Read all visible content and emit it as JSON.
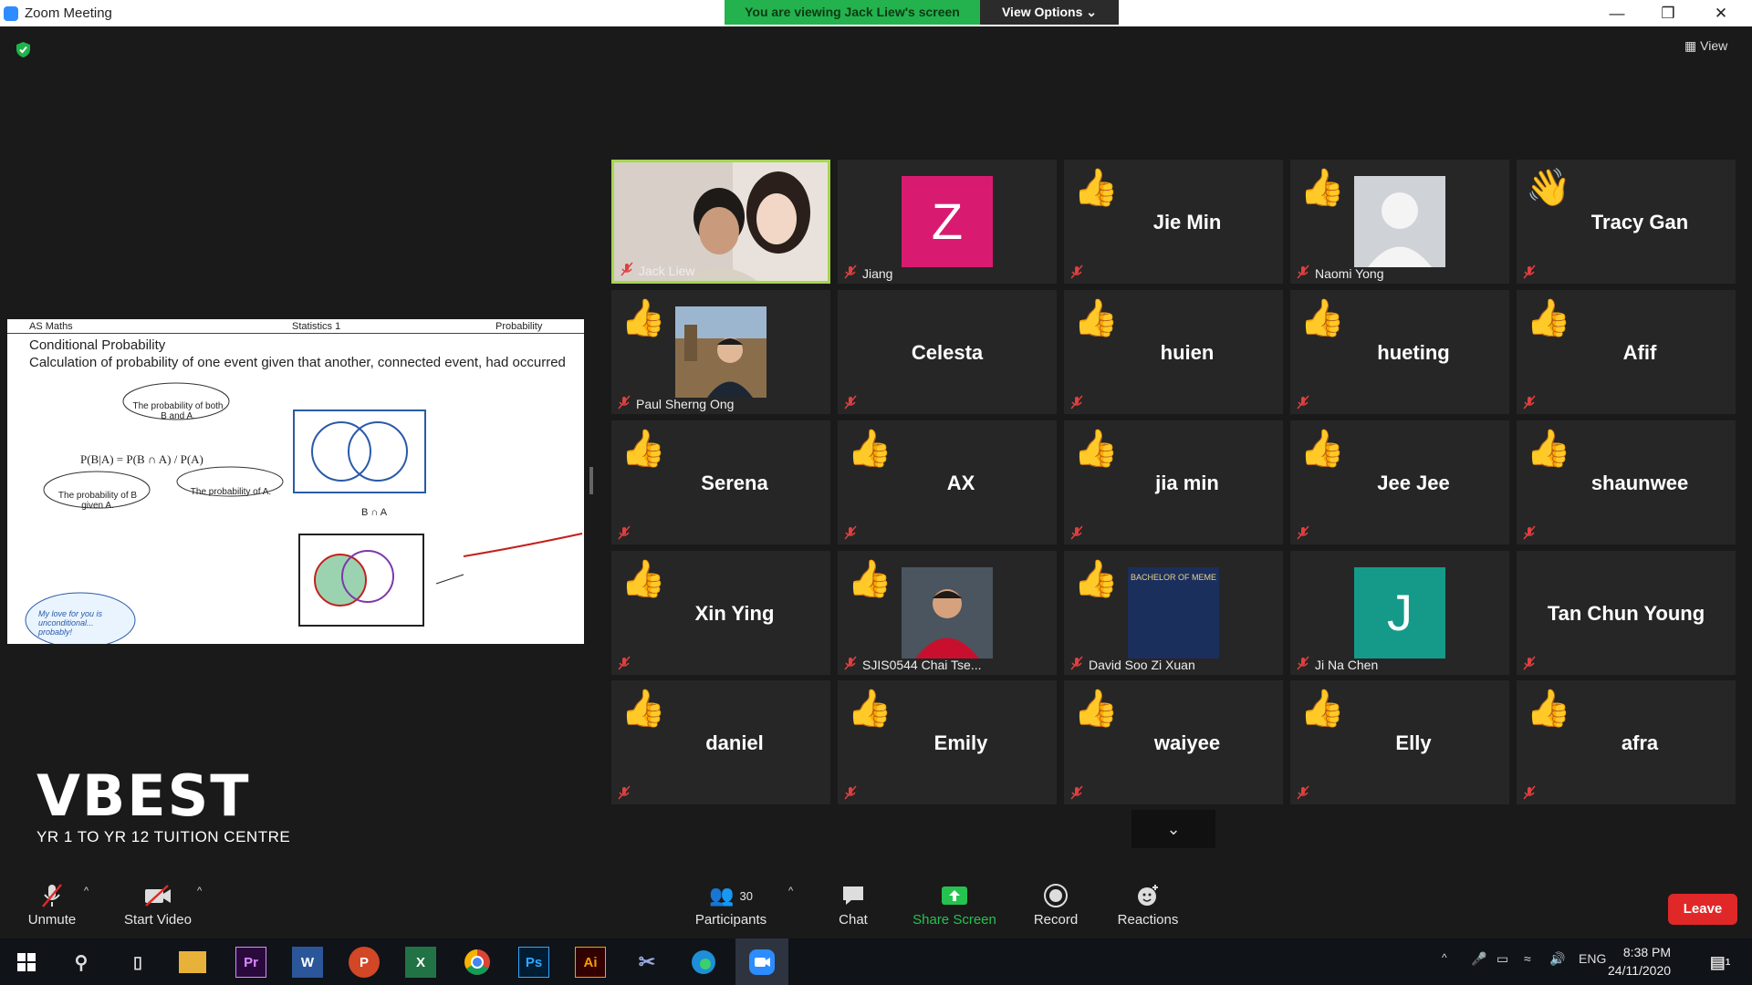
{
  "window": {
    "title": "Zoom Meeting",
    "banner": "You are viewing Jack Liew's screen",
    "view_options": "View Options ⌄",
    "min": "—",
    "max": "❒",
    "close": "✕"
  },
  "stage": {
    "view_label": "View"
  },
  "share": {
    "header_left": "AS Maths",
    "header_mid": "Statistics 1",
    "header_right": "Probability",
    "title": "Conditional Probability",
    "subtitle": "Calculation of probability of one event given that another, connected event, had occurred",
    "bubble1": "The probability of both B and A.",
    "bubble2": "The probability of B given A.",
    "bubble3": "The probability of A.",
    "formula": "P(B|A) = P(B ∩ A) / P(A)",
    "caption": "B ∩ A",
    "note": "My love for you is unconditional... probably!"
  },
  "logo": {
    "name": "VBEST",
    "tagline": "YR 1 TO YR 12 TUITION CENTRE"
  },
  "participants": [
    {
      "name": "Jack Liew",
      "kind": "video",
      "react": "",
      "caption": "Jack Liew",
      "active": true
    },
    {
      "name": "Jiang",
      "kind": "letter",
      "letter": "Z",
      "color": "#d81b71",
      "react": "",
      "caption": "Jiang"
    },
    {
      "name": "Jie Min",
      "kind": "name",
      "react": "👍"
    },
    {
      "name": "Naomi Yong",
      "kind": "silhouette",
      "react": "👍",
      "caption": "Naomi Yong"
    },
    {
      "name": "Tracy Gan",
      "kind": "name",
      "react": "👋"
    },
    {
      "name": "Paul Sherng Ong",
      "kind": "photo",
      "react": "👍",
      "caption": "Paul Sherng Ong"
    },
    {
      "name": "Celesta",
      "kind": "name",
      "react": ""
    },
    {
      "name": "huien",
      "kind": "name",
      "react": "👍"
    },
    {
      "name": "hueting",
      "kind": "name",
      "react": "👍"
    },
    {
      "name": "Afif",
      "kind": "name",
      "react": "👍"
    },
    {
      "name": "Serena",
      "kind": "name",
      "react": "👍"
    },
    {
      "name": "AX",
      "kind": "name",
      "react": "👍"
    },
    {
      "name": "jia min",
      "kind": "name",
      "react": "👍"
    },
    {
      "name": "Jee Jee",
      "kind": "name",
      "react": "👍"
    },
    {
      "name": "shaunwee",
      "kind": "name",
      "react": "👍"
    },
    {
      "name": "Xin Ying",
      "kind": "name",
      "react": "👍"
    },
    {
      "name": "SJIS0544 Chai Tse...",
      "kind": "photo2",
      "react": "👍",
      "caption": "SJIS0544 Chai Tse..."
    },
    {
      "name": "David Soo Zi Xuan",
      "kind": "photo3",
      "react": "👍",
      "caption": "David Soo Zi Xuan",
      "photo_text": "BACHELOR OF MEME"
    },
    {
      "name": "Ji Na Chen",
      "kind": "letter",
      "letter": "J",
      "color": "#159a8a",
      "react": "",
      "caption": "Ji Na Chen"
    },
    {
      "name": "Tan Chun Young",
      "kind": "name",
      "react": ""
    },
    {
      "name": "daniel",
      "kind": "name",
      "react": "👍"
    },
    {
      "name": "Emily",
      "kind": "name",
      "react": "👍"
    },
    {
      "name": "waiyee",
      "kind": "name",
      "react": "👍"
    },
    {
      "name": "Elly",
      "kind": "name",
      "react": "👍"
    },
    {
      "name": "afra",
      "kind": "name",
      "react": "👍"
    }
  ],
  "toolbar": {
    "unmute": "Unmute",
    "start_video": "Start Video",
    "participants": "Participants",
    "participants_count": "30",
    "chat": "Chat",
    "share_screen": "Share Screen",
    "record": "Record",
    "reactions": "Reactions",
    "leave": "Leave"
  },
  "taskbar": {
    "lang": "ENG",
    "time": "8:38 PM",
    "date": "24/11/2020",
    "notif_count": "1",
    "apps": [
      "Pr",
      "W",
      "P",
      "X",
      "Ps",
      "Ai"
    ]
  }
}
